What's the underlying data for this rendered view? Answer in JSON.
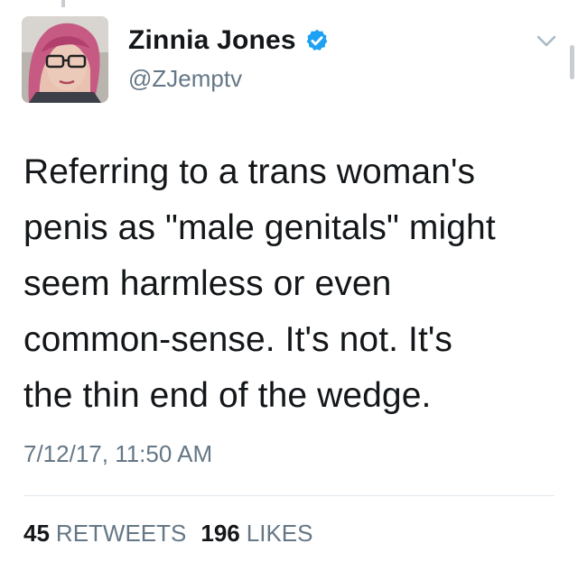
{
  "user": {
    "display_name": "Zinnia Jones",
    "handle": "@ZJemptv",
    "verified": true,
    "verified_icon": "verified-badge-icon"
  },
  "menu": {
    "icon": "chevron-down-icon"
  },
  "tweet": {
    "lines": [
      "Referring to a trans woman's",
      "penis as \"male genitals\" might",
      "seem harmless or even",
      "common-sense. It's not. It's",
      "the thin end of the wedge."
    ],
    "timestamp": "7/12/17, 11:50 AM"
  },
  "stats": {
    "retweets_count": "45",
    "retweets_label": "RETWEETS",
    "likes_count": "196",
    "likes_label": "LIKES"
  },
  "colors": {
    "text": "#14171a",
    "secondary": "#657786",
    "verified_blue": "#1da1f2",
    "divider": "#e1e8ed"
  }
}
